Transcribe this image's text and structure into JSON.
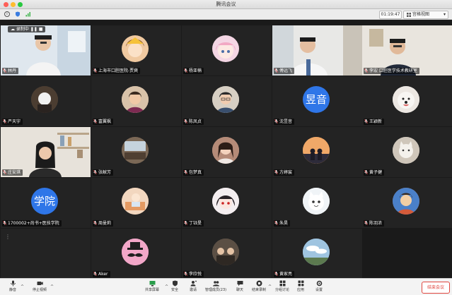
{
  "window": {
    "title": "腾讯会议"
  },
  "infobar": {
    "timer": "01:19:47",
    "view_label": "宫格视图"
  },
  "recording": {
    "label": "录制中"
  },
  "participants": [
    {
      "name": "林丹",
      "kind": "video",
      "scene": "man-office"
    },
    {
      "name": "上海市口腔医院-贾爽",
      "kind": "avatar",
      "icon": "cartoon-girl-icon",
      "bg": "#f0c9a0"
    },
    {
      "name": "杨亚楠",
      "kind": "avatar",
      "icon": "anime-girl-icon",
      "bg": "#f4d6e4"
    },
    {
      "name": "傅远飞",
      "kind": "video",
      "scene": "man-lab"
    },
    {
      "name": "李宏 口腔医学技术教研室",
      "kind": "video",
      "scene": "man-wall"
    },
    {
      "name": "严天宇",
      "kind": "avatar",
      "icon": "masked-figure-icon",
      "bg": "#5a4a3c"
    },
    {
      "name": "富翼枫",
      "kind": "avatar",
      "icon": "woman-portrait-icon",
      "bg": "#e8d4c0"
    },
    {
      "name": "陈凤贞",
      "kind": "avatar",
      "icon": "woman-glasses-icon",
      "bg": "#e0d5c8"
    },
    {
      "name": "沈昱音",
      "kind": "text",
      "text": "昱音",
      "bg": "#2f76e8"
    },
    {
      "name": "王颖新",
      "kind": "avatar",
      "icon": "dog-icon",
      "bg": "#e9e4df"
    },
    {
      "name": "庄安琪",
      "kind": "video",
      "scene": "woman-shelf"
    },
    {
      "name": "张献芳",
      "kind": "avatar",
      "icon": "room-icon",
      "bg": "#6c5a4a"
    },
    {
      "name": "包梦真",
      "kind": "avatar",
      "icon": "woman-photo-icon",
      "bg": "#c9a38f"
    },
    {
      "name": "方婷宸",
      "kind": "avatar",
      "icon": "sunset-couple-icon",
      "bg": "#e39a55"
    },
    {
      "name": "黄子健",
      "kind": "avatar",
      "icon": "cat-icon",
      "bg": "#d9d2c8"
    },
    {
      "name": "1700002+尚书+医技学院",
      "kind": "text",
      "text": "学院",
      "bg": "#2f76e8"
    },
    {
      "name": "周曼莉",
      "kind": "avatar",
      "icon": "cartoon-room-icon",
      "bg": "#e7b28a"
    },
    {
      "name": "丁钰旻",
      "kind": "avatar",
      "icon": "anime-char-icon",
      "bg": "#ede2e5"
    },
    {
      "name": "朱昊",
      "kind": "avatar",
      "icon": "cartoon-cat-icon",
      "bg": "#eef2f4"
    },
    {
      "name": "陈羽浓",
      "kind": "avatar",
      "icon": "cartoon-boy-icon",
      "bg": "#d97a4a"
    },
    {
      "name": "",
      "kind": "blank"
    },
    {
      "name": "Aker",
      "kind": "avatar",
      "icon": "mustache-icon",
      "bg": "#f2a7c8"
    },
    {
      "name": "李欣悦",
      "kind": "avatar",
      "icon": "group-photo-icon",
      "bg": "#6b5e50"
    },
    {
      "name": "黄家亮",
      "kind": "avatar",
      "icon": "sky-icon",
      "bg": "#9fc4e0"
    }
  ],
  "toolbar": {
    "items": [
      {
        "label": "静音",
        "icon": "microphone-icon"
      },
      {
        "label": "停止视频",
        "icon": "camera-icon"
      },
      {
        "label": "共享屏幕",
        "icon": "share-screen-icon"
      },
      {
        "label": "安全",
        "icon": "shield-icon"
      },
      {
        "label": "邀请",
        "icon": "invite-icon"
      },
      {
        "label": "管理成员(23)",
        "icon": "members-icon"
      },
      {
        "label": "聊天",
        "icon": "chat-icon"
      },
      {
        "label": "结束录制",
        "icon": "record-stop-icon"
      },
      {
        "label": "分组讨论",
        "icon": "breakout-icon"
      },
      {
        "label": "应用",
        "icon": "apps-icon"
      },
      {
        "label": "设置",
        "icon": "gear-icon"
      }
    ],
    "end_label": "结束会议"
  },
  "colors": {
    "accent": "#2f76e8",
    "end": "#e0463f",
    "speaker": "#5bd36b"
  }
}
